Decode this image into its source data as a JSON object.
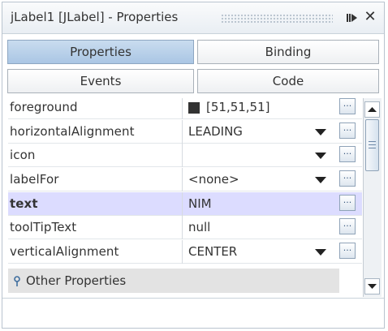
{
  "window": {
    "title": "jLabel1 [JLabel] - Properties",
    "float_icon": "float-icon",
    "close_label": "✕"
  },
  "tabs": [
    {
      "label": "Properties",
      "selected": true
    },
    {
      "label": "Binding",
      "selected": false
    },
    {
      "label": "Events",
      "selected": false
    },
    {
      "label": "Code",
      "selected": false
    }
  ],
  "properties": [
    {
      "name": "foreground",
      "value": "[51,51,51]",
      "swatch_color": "#333333",
      "has_dropdown": false,
      "bold": false
    },
    {
      "name": "horizontalAlignment",
      "value": "LEADING",
      "has_dropdown": true,
      "bold": false
    },
    {
      "name": "icon",
      "value": "",
      "has_dropdown": true,
      "bold": false
    },
    {
      "name": "labelFor",
      "value": "<none>",
      "has_dropdown": true,
      "bold": false
    },
    {
      "name": "text",
      "value": "NIM",
      "has_dropdown": false,
      "bold": true,
      "selected": true
    },
    {
      "name": "toolTipText",
      "value": "null",
      "has_dropdown": false,
      "bold": false
    },
    {
      "name": "verticalAlignment",
      "value": "CENTER",
      "has_dropdown": true,
      "bold": false
    }
  ],
  "editor_button_label": "...",
  "category": {
    "label": "Other Properties",
    "icon": "pin-icon"
  },
  "colors": {
    "selected_row": "#dcdcff",
    "selected_tab": "#aac6e4",
    "category_bg": "#e3e3e3"
  }
}
